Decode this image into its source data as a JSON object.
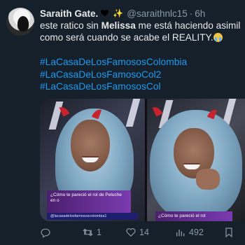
{
  "tweet": {
    "author_name": "Saraith Gate.",
    "author_emojis": "✨",
    "handle": "@saraithnlc15",
    "separator": "·",
    "time": "6h",
    "text_line1_before": "este ratico sin ",
    "text_bold": "Melissa",
    "text_line1_after": " me está haciendo asimil",
    "text_line2": "como será cuando se acabe el REALITY.",
    "hashtags": [
      "#LaCasaDeLosFamososColombia",
      "#LaCasaDeLosFamosoCol2",
      "#LaCasaDeLosFamososCol"
    ]
  },
  "media": {
    "caption_left": "¿Cómo te pareció el rol de Peluche en o",
    "caption_left_sub": "@lacasadelosfamososcolombia1",
    "caption_right": "¿Cómo te pareció el rol"
  },
  "actions": {
    "reply_count": "",
    "retweet_count": "1",
    "like_count": "14",
    "views_count": "492"
  },
  "colors": {
    "background": "#15202b",
    "text": "#e7e9ea",
    "secondary": "#8b98a5",
    "link": "#1d9bf0"
  }
}
